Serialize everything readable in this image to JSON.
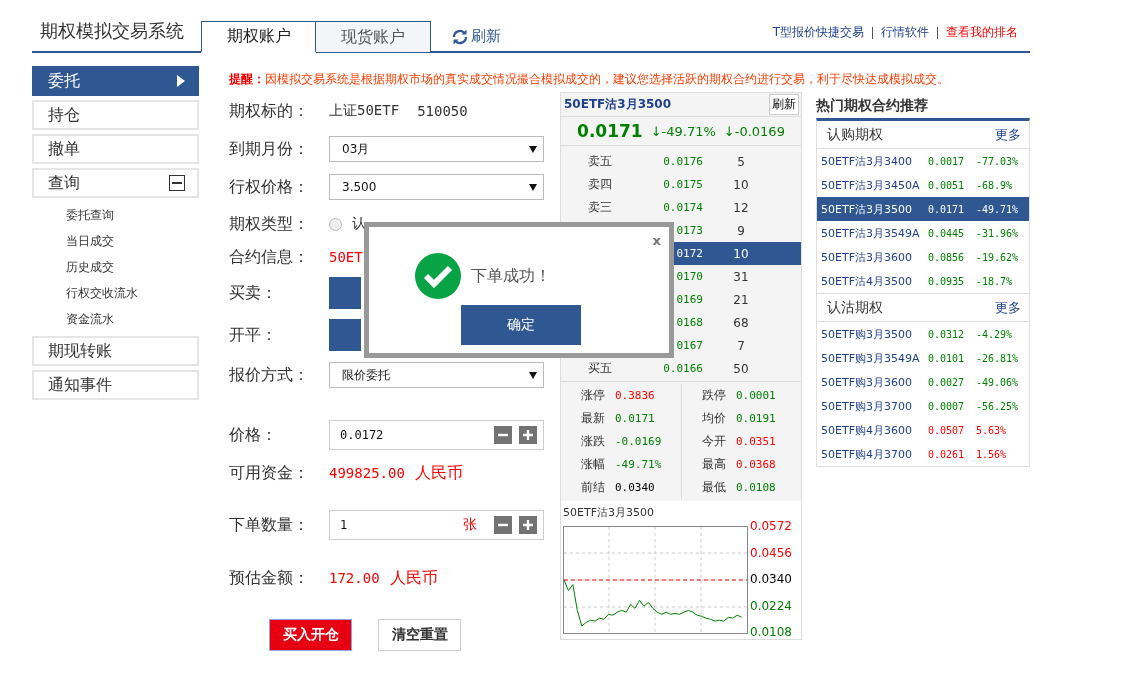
{
  "header": {
    "title": "期权模拟交易系统",
    "tabs": [
      {
        "label": "期权账户",
        "selected": true
      },
      {
        "label": "现货账户",
        "selected": false
      }
    ],
    "refresh": "刷新",
    "links": [
      {
        "label": "T型报价快捷交易",
        "kind": "normal"
      },
      {
        "label": "行情软件",
        "kind": "normal"
      },
      {
        "label": "查看我的排名",
        "kind": "highlight"
      }
    ]
  },
  "sidebar": {
    "items": [
      {
        "label": "委托",
        "selected": true
      },
      {
        "label": "持仓",
        "selected": false
      },
      {
        "label": "撤单",
        "selected": false
      },
      {
        "label": "查询",
        "selected": false,
        "expanded": true,
        "children": [
          {
            "label": "委托查询"
          },
          {
            "label": "当日成交"
          },
          {
            "label": "历史成交"
          },
          {
            "label": "行权交收流水"
          },
          {
            "label": "资金流水"
          }
        ]
      },
      {
        "label": "期现转账",
        "selected": false
      },
      {
        "label": "通知事件",
        "selected": false
      }
    ]
  },
  "notice": {
    "label": "提醒：",
    "text": "因模拟交易系统是根据期权市场的真实成交情况撮合模拟成交的，建议您选择活跃的期权合约进行交易，利于尽快达成模拟成交。"
  },
  "form": {
    "rows": [
      {
        "kind": "text",
        "label": "期权标的：",
        "values": [
          "上证50ETF",
          "510050"
        ]
      },
      {
        "kind": "select",
        "label": "到期月份：",
        "value": "03月"
      },
      {
        "kind": "select",
        "label": "行权价格：",
        "value": "3.500"
      },
      {
        "kind": "radio",
        "label": "期权类型：",
        "options": [
          {
            "label": "认",
            "selected": false
          }
        ]
      },
      {
        "kind": "info",
        "label": "合约信息：",
        "value": "50ET"
      },
      {
        "kind": "toggle",
        "label": "买卖："
      },
      {
        "kind": "toggle",
        "label": "开平："
      },
      {
        "kind": "select",
        "label": "报价方式：",
        "value": "限价委托"
      },
      {
        "kind": "stepper",
        "label": "价格：",
        "value": "0.0172"
      },
      {
        "kind": "amount",
        "label": "可用资金：",
        "value": "499825.00",
        "unit": "人民币"
      },
      {
        "kind": "stepper",
        "label": "下单数量：",
        "value": "1",
        "unit": "张"
      },
      {
        "kind": "amount",
        "label": "预估金额：",
        "value": "172.00",
        "unit": "人民币"
      }
    ],
    "buttons": [
      {
        "label": "买入开仓",
        "kind": "primary"
      },
      {
        "label": "清空重置",
        "kind": "plain"
      }
    ]
  },
  "quote": {
    "title": "50ETF沽3月3500",
    "refresh": "刷新",
    "last": "0.0171",
    "change_pct": "↓-49.71%",
    "change": "↓-0.0169",
    "book": [
      {
        "label": "卖五",
        "price": "0.0176",
        "volume": "5",
        "selected": false
      },
      {
        "label": "卖四",
        "price": "0.0175",
        "volume": "10",
        "selected": false
      },
      {
        "label": "卖三",
        "price": "0.0174",
        "volume": "12",
        "selected": false
      },
      {
        "price": "0173",
        "volume": "9",
        "selected": false
      },
      {
        "price": "0172",
        "volume": "10",
        "selected": true
      },
      {
        "price": "0170",
        "volume": "31",
        "selected": false
      },
      {
        "price": "0169",
        "volume": "21",
        "selected": false
      },
      {
        "price": "0168",
        "volume": "68",
        "selected": false
      },
      {
        "price": "0167",
        "volume": "7",
        "selected": false
      },
      {
        "label": "买五",
        "price": "0.0166",
        "volume": "50",
        "selected": false
      }
    ],
    "stats": [
      {
        "label": "涨停",
        "value": "0.3836",
        "color": "#ff0000"
      },
      {
        "label": "跌停",
        "value": "0.0001",
        "color": "#008000"
      },
      {
        "label": "最新",
        "value": "0.0171",
        "color": "#008000"
      },
      {
        "label": "均价",
        "value": "0.0191",
        "color": "#008000"
      },
      {
        "label": "涨跌",
        "value": "-0.0169",
        "color": "#008000"
      },
      {
        "label": "今开",
        "value": "0.0351",
        "color": "#ff0000"
      },
      {
        "label": "涨幅",
        "value": "-49.71%",
        "color": "#008000"
      },
      {
        "label": "最高",
        "value": "0.0368",
        "color": "#ff0000"
      },
      {
        "label": "前结",
        "value": "0.0340",
        "color": "#000000"
      },
      {
        "label": "最低",
        "value": "0.0108",
        "color": "#008000"
      }
    ],
    "chart_data": {
      "type": "line",
      "title": "50ETF沽3月3500",
      "grid": true,
      "ylim": [
        0.0108,
        0.0572
      ],
      "yticks": [
        {
          "value": 0.0572,
          "label": "0.0572"
        },
        {
          "value": 0.0456,
          "label": "0.0456"
        },
        {
          "value": 0.034,
          "label": "0.0340"
        },
        {
          "value": 0.0224,
          "label": "0.0224"
        },
        {
          "value": 0.0108,
          "label": "0.0108"
        }
      ],
      "ref_lines": [
        {
          "axis": "y",
          "value": 0.034,
          "color": "#ff0000"
        }
      ],
      "series": [
        {
          "color": "#008000",
          "values": [
            0.034,
            0.0294,
            0.032,
            0.0207,
            0.0138,
            0.0155,
            0.0164,
            0.016,
            0.0173,
            0.0168,
            0.019,
            0.0186,
            0.0199,
            0.0207,
            0.0199,
            0.0233,
            0.0216,
            0.0251,
            0.0225,
            0.0242,
            0.0216,
            0.0199,
            0.019,
            0.0199,
            0.019,
            0.0194,
            0.019,
            0.0199,
            0.0207,
            0.0199,
            0.0186,
            0.0181,
            0.0173,
            0.0168,
            0.016,
            0.0164,
            0.016,
            0.0177,
            0.0173,
            0.0186,
            0.0177
          ]
        }
      ]
    }
  },
  "hot": {
    "title": "热门期权合约推荐",
    "sections": [
      {
        "title": "认购期权",
        "more": "更多",
        "rows": [
          {
            "name": "50ETF沽3月3400",
            "price": "0.0017",
            "change": "-77.03%",
            "color": "#008000",
            "selected": false
          },
          {
            "name": "50ETF沽3月3450A",
            "price": "0.0051",
            "change": "-68.9%",
            "color": "#008000",
            "selected": false
          },
          {
            "name": "50ETF沽3月3500",
            "price": "0.0171",
            "change": "-49.71%",
            "selected": true
          },
          {
            "name": "50ETF沽3月3549A",
            "price": "0.0445",
            "change": "-31.96%",
            "color": "#008000",
            "selected": false
          },
          {
            "name": "50ETF沽3月3600",
            "price": "0.0856",
            "change": "-19.62%",
            "color": "#008000",
            "selected": false
          },
          {
            "name": "50ETF沽4月3500",
            "price": "0.0935",
            "change": "-18.7%",
            "color": "#008000",
            "selected": false
          }
        ]
      },
      {
        "title": "认沽期权",
        "more": "更多",
        "rows": [
          {
            "name": "50ETF购3月3500",
            "price": "0.0312",
            "change": "-4.29%",
            "color": "#008000",
            "selected": false
          },
          {
            "name": "50ETF购3月3549A",
            "price": "0.0101",
            "change": "-26.81%",
            "color": "#008000",
            "selected": false
          },
          {
            "name": "50ETF购3月3600",
            "price": "0.0027",
            "change": "-49.06%",
            "color": "#008000",
            "selected": false
          },
          {
            "name": "50ETF购3月3700",
            "price": "0.0007",
            "change": "-56.25%",
            "color": "#008000",
            "selected": false
          },
          {
            "name": "50ETF购4月3600",
            "price": "0.0507",
            "change": "5.63%",
            "color": "#ff0000",
            "selected": false
          },
          {
            "name": "50ETF购4月3700",
            "price": "0.0261",
            "change": "1.56%",
            "color": "#ff0000",
            "selected": false
          }
        ]
      }
    ]
  },
  "dialog": {
    "close": "x",
    "message": "下单成功！",
    "button": "确定"
  }
}
